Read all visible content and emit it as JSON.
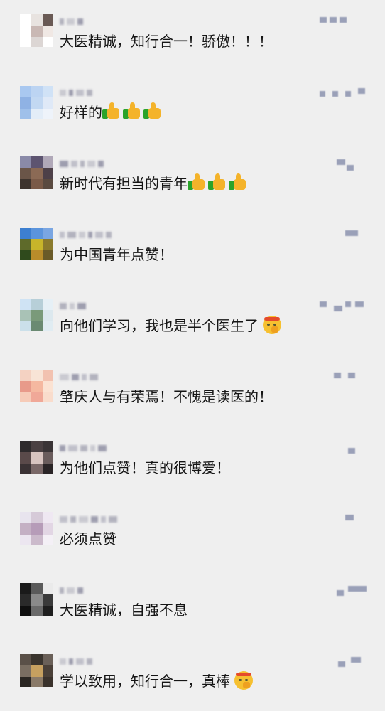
{
  "comments": [
    {
      "id": 1,
      "text": "大医精诚，知行合一！骄傲！！！",
      "emoji": [],
      "avatar_colors": [
        "#ffffff",
        "#e8e3e0",
        "#6a5a55",
        "#ffffff",
        "#c9b8b4",
        "#f0e8e4",
        "#ffffff",
        "#dcd6d4",
        "#ffffff"
      ]
    },
    {
      "id": 2,
      "text": "好样的",
      "emoji": [
        "thumbs-up",
        "thumbs-up",
        "thumbs-up"
      ],
      "avatar_colors": [
        "#a9c8f0",
        "#bcd4f2",
        "#d0e2f6",
        "#8fb2e4",
        "#c2d8f2",
        "#dfe9f7",
        "#9fc0ea",
        "#e3edf8",
        "#eef3fa"
      ]
    },
    {
      "id": 3,
      "text": "新时代有担当的青年",
      "emoji": [
        "thumbs-up",
        "thumbs-up",
        "thumbs-up"
      ],
      "avatar_colors": [
        "#8a8aa8",
        "#5d5470",
        "#b0a8b8",
        "#6a5548",
        "#8b6a55",
        "#4d4048",
        "#3e342e",
        "#7a5a48",
        "#5a4a40"
      ]
    },
    {
      "id": 4,
      "text": "为中国青年点赞！",
      "emoji": [],
      "avatar_colors": [
        "#3d7fd0",
        "#5b94dc",
        "#7aa6e2",
        "#5e6a2a",
        "#c7b52a",
        "#8a7a2c",
        "#2f4a1c",
        "#b88c2a",
        "#6a5a28"
      ]
    },
    {
      "id": 5,
      "text": "向他们学习，我也是半个医生了",
      "emoji": [
        "shush-face"
      ],
      "avatar_colors": [
        "#cfe3f4",
        "#b7cfd8",
        "#e6f0f6",
        "#a9c2b6",
        "#7a9a7a",
        "#dce8ee",
        "#cbe0ea",
        "#6a8a72",
        "#e0ecf2"
      ]
    },
    {
      "id": 6,
      "text": "肇庆人与有荣焉！不愧是读医的！",
      "emoji": [],
      "avatar_colors": [
        "#f4d2c2",
        "#f8e4d6",
        "#f2c2b0",
        "#e89a8a",
        "#f5b8a0",
        "#fbe2d2",
        "#f6cbb8",
        "#f0a898",
        "#f9dccc"
      ]
    },
    {
      "id": 7,
      "text": "为他们点赞！真的很博爱！",
      "emoji": [],
      "avatar_colors": [
        "#2e2a2c",
        "#4a4042",
        "#3a3436",
        "#5a4a4a",
        "#d8c4c0",
        "#6a5c5c",
        "#3a3234",
        "#7a6868",
        "#2a2426"
      ]
    },
    {
      "id": 8,
      "text": "必须点赞",
      "emoji": [],
      "avatar_colors": [
        "#e8e4ee",
        "#d6cad8",
        "#efe8f2",
        "#c4b0c4",
        "#b69cb8",
        "#e2d6e4",
        "#ece6f0",
        "#cbbacb",
        "#f4f0f6"
      ]
    },
    {
      "id": 9,
      "text": "大医精诚，自强不息",
      "emoji": [],
      "avatar_colors": [
        "#1a1a1a",
        "#5a5a5a",
        "#eaeaea",
        "#2a2a2a",
        "#8a8a8a",
        "#3a3a3a",
        "#0f0f0f",
        "#6a6a6a",
        "#1e1e1e"
      ]
    },
    {
      "id": 10,
      "text": "学以致用，知行合一，真棒",
      "emoji": [
        "shush-face"
      ],
      "avatar_colors": [
        "#5a5048",
        "#3a342e",
        "#6a6058",
        "#7a6e62",
        "#c6a060",
        "#4a4038",
        "#2a2622",
        "#8a7a68",
        "#3a322c"
      ]
    }
  ]
}
